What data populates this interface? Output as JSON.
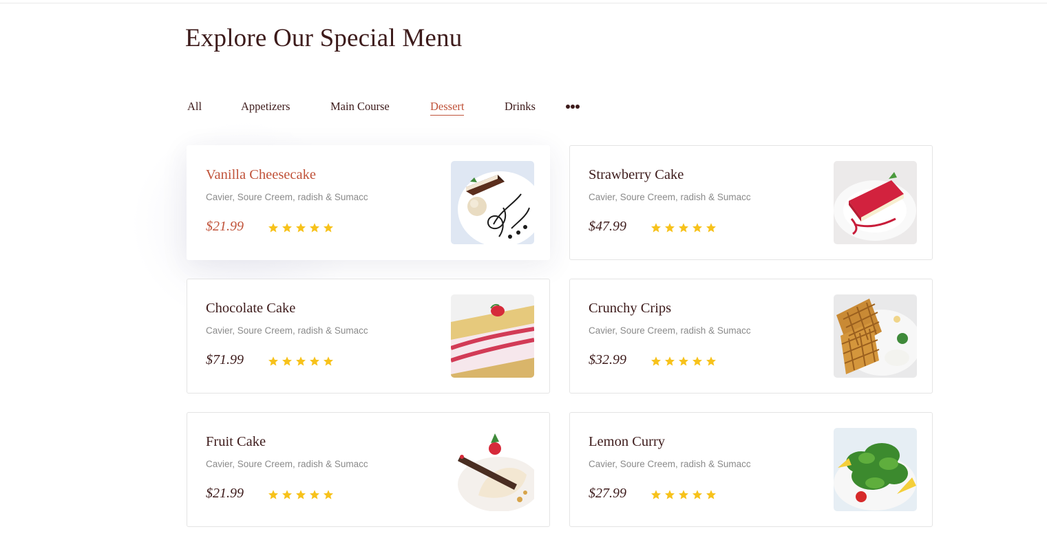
{
  "page": {
    "title": "Explore Our Special Menu"
  },
  "tabs": {
    "items": [
      {
        "label": "All",
        "active": false
      },
      {
        "label": "Appetizers",
        "active": false
      },
      {
        "label": "Main Course",
        "active": false
      },
      {
        "label": "Dessert",
        "active": true
      },
      {
        "label": "Drinks",
        "active": false
      }
    ],
    "more_icon": "more-horizontal-icon"
  },
  "menu": {
    "items": [
      {
        "name": "Vanilla Cheesecake",
        "desc": "Cavier, Soure Creem, radish & Sumacc",
        "price": "$21.99",
        "rating": 5,
        "image": "vanilla-cheesecake-photo",
        "featured": true
      },
      {
        "name": "Strawberry Cake",
        "desc": "Cavier, Soure Creem, radish & Sumacc",
        "price": "$47.99",
        "rating": 5,
        "image": "strawberry-cake-photo",
        "featured": false
      },
      {
        "name": "Chocolate Cake",
        "desc": "Cavier, Soure Creem, radish & Sumacc",
        "price": "$71.99",
        "rating": 5,
        "image": "chocolate-cake-photo",
        "featured": false
      },
      {
        "name": "Crunchy Crips",
        "desc": "Cavier, Soure Creem, radish & Sumacc",
        "price": "$32.99",
        "rating": 5,
        "image": "crunchy-crips-photo",
        "featured": false
      },
      {
        "name": "Fruit Cake",
        "desc": "Cavier, Soure Creem, radish & Sumacc",
        "price": "$21.99",
        "rating": 5,
        "image": "fruit-cake-photo",
        "featured": false
      },
      {
        "name": "Lemon Curry",
        "desc": "Cavier, Soure Creem, radish & Sumacc",
        "price": "$27.99",
        "rating": 5,
        "image": "lemon-curry-photo",
        "featured": false
      }
    ]
  },
  "colors": {
    "heading": "#3d1b1b",
    "accent": "#c0533a",
    "muted": "#8a8a8a",
    "star": "#f7c21b",
    "card_border": "#e4e4e4"
  }
}
